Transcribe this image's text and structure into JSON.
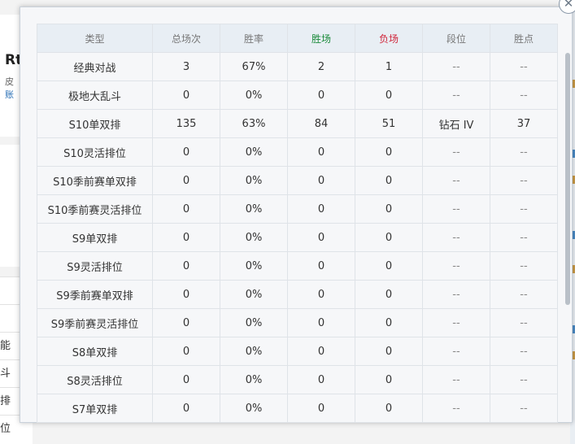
{
  "background": {
    "title_fragment": "Rt",
    "line1_fragment": "皮",
    "line2_fragment": "账",
    "list_fragments": [
      "",
      "",
      "能",
      "斗",
      "排",
      "位"
    ]
  },
  "dialog": {
    "close_icon": "close-icon",
    "table": {
      "columns": [
        "类型",
        "总场次",
        "胜率",
        "胜场",
        "负场",
        "段位",
        "胜点"
      ],
      "column_colors": {
        "win": "#1a8a3a",
        "loss": "#d0253a"
      },
      "rows": [
        [
          "经典对战",
          "3",
          "67%",
          "2",
          "1",
          "--",
          "--"
        ],
        [
          "极地大乱斗",
          "0",
          "0%",
          "0",
          "0",
          "--",
          "--"
        ],
        [
          "S10单双排",
          "135",
          "63%",
          "84",
          "51",
          "钻石 IV",
          "37"
        ],
        [
          "S10灵活排位",
          "0",
          "0%",
          "0",
          "0",
          "--",
          "--"
        ],
        [
          "S10季前赛单双排",
          "0",
          "0%",
          "0",
          "0",
          "--",
          "--"
        ],
        [
          "S10季前赛灵活排位",
          "0",
          "0%",
          "0",
          "0",
          "--",
          "--"
        ],
        [
          "S9单双排",
          "0",
          "0%",
          "0",
          "0",
          "--",
          "--"
        ],
        [
          "S9灵活排位",
          "0",
          "0%",
          "0",
          "0",
          "--",
          "--"
        ],
        [
          "S9季前赛单双排",
          "0",
          "0%",
          "0",
          "0",
          "--",
          "--"
        ],
        [
          "S9季前赛灵活排位",
          "0",
          "0%",
          "0",
          "0",
          "--",
          "--"
        ],
        [
          "S8单双排",
          "0",
          "0%",
          "0",
          "0",
          "--",
          "--"
        ],
        [
          "S8灵活排位",
          "0",
          "0%",
          "0",
          "0",
          "--",
          "--"
        ],
        [
          "S7单双排",
          "0",
          "0%",
          "0",
          "0",
          "--",
          "--"
        ]
      ]
    }
  }
}
